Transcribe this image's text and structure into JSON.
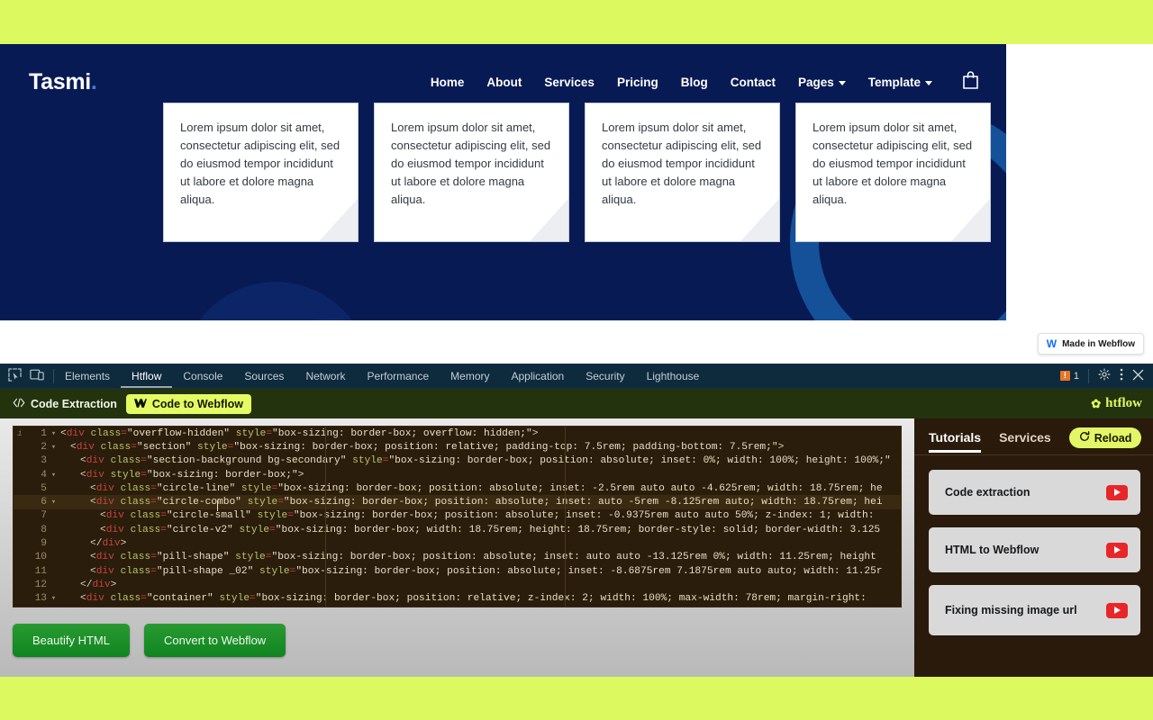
{
  "website": {
    "brand": {
      "name": "Tasmi",
      "dot": "."
    },
    "nav": [
      {
        "label": "Home",
        "caret": false
      },
      {
        "label": "About",
        "caret": false
      },
      {
        "label": "Services",
        "caret": false
      },
      {
        "label": "Pricing",
        "caret": false
      },
      {
        "label": "Blog",
        "caret": false
      },
      {
        "label": "Contact",
        "caret": false
      },
      {
        "label": "Pages",
        "caret": true
      },
      {
        "label": "Template",
        "caret": true
      }
    ],
    "cart_icon": "shopping-bag-icon",
    "cards": [
      {
        "text": "Lorem ipsum dolor sit amet, consectetur adipiscing elit, sed do eiusmod tempor incididunt ut labore et dolore magna aliqua."
      },
      {
        "text": "Lorem ipsum dolor sit amet, consectetur adipiscing elit, sed do eiusmod tempor incididunt ut labore et dolore magna aliqua."
      },
      {
        "text": "Lorem ipsum dolor sit amet, consectetur adipiscing elit, sed do eiusmod tempor incididunt ut labore et dolore magna aliqua."
      },
      {
        "text": "Lorem ipsum dolor sit amet, consectetur adipiscing elit, sed do eiusmod tempor incididunt ut labore et dolore magna aliqua."
      }
    ],
    "badge": {
      "logo": "webflow-logo-icon",
      "label": "Made in Webflow"
    },
    "colors": {
      "hero_bg": "#071a54",
      "ring": "#145199",
      "page_bg": "#dcf95f"
    }
  },
  "devtools": {
    "left_icons": [
      "inspect-element-icon",
      "device-toolbar-icon"
    ],
    "tabs": [
      {
        "label": "Elements",
        "active": false
      },
      {
        "label": "Htflow",
        "active": true
      },
      {
        "label": "Console",
        "active": false
      },
      {
        "label": "Sources",
        "active": false
      },
      {
        "label": "Network",
        "active": false
      },
      {
        "label": "Performance",
        "active": false
      },
      {
        "label": "Memory",
        "active": false
      },
      {
        "label": "Application",
        "active": false
      },
      {
        "label": "Security",
        "active": false
      },
      {
        "label": "Lighthouse",
        "active": false
      }
    ],
    "error_count": "1",
    "right_icons": [
      "settings-gear-icon",
      "more-options-icon",
      "close-icon"
    ]
  },
  "htflow": {
    "toolbar": {
      "code_extraction": "Code Extraction",
      "code_extraction_icon": "code-brackets-icon",
      "code_to_webflow": "Code to Webflow",
      "code_to_webflow_icon": "webflow-logo-icon",
      "brand": "htflow",
      "brand_icon": "htflow-logo-icon"
    },
    "editor": {
      "lines": [
        {
          "n": "1",
          "fold": "▾",
          "indent": 0,
          "tokens": [
            {
              "t": "br",
              "v": "<"
            },
            {
              "t": "tg",
              "v": "div"
            },
            {
              "t": "pn",
              "v": " class"
            },
            {
              "t": "eq",
              "v": "="
            },
            {
              "t": "st",
              "v": "\"overflow-hidden\""
            },
            {
              "t": "pn",
              "v": " style"
            },
            {
              "t": "eq",
              "v": "="
            },
            {
              "t": "st",
              "v": "\"box-sizing: border-box; overflow: hidden;\""
            },
            {
              "t": "br",
              "v": ">"
            }
          ]
        },
        {
          "n": "2",
          "fold": "▾",
          "indent": 1,
          "tokens": [
            {
              "t": "br",
              "v": "<"
            },
            {
              "t": "tg",
              "v": "div"
            },
            {
              "t": "pn",
              "v": " class"
            },
            {
              "t": "eq",
              "v": "="
            },
            {
              "t": "st",
              "v": "\"section\""
            },
            {
              "t": "pn",
              "v": " style"
            },
            {
              "t": "eq",
              "v": "="
            },
            {
              "t": "st",
              "v": "\"box-sizing: border-box; position: relative; padding-top: 7.5rem; padding-bottom: 7.5rem;\""
            },
            {
              "t": "br",
              "v": ">"
            }
          ]
        },
        {
          "n": "3",
          "fold": "",
          "indent": 2,
          "tokens": [
            {
              "t": "br",
              "v": "<"
            },
            {
              "t": "tg",
              "v": "div"
            },
            {
              "t": "pn",
              "v": " class"
            },
            {
              "t": "eq",
              "v": "="
            },
            {
              "t": "st",
              "v": "\"section-background bg-secondary\""
            },
            {
              "t": "pn",
              "v": " style"
            },
            {
              "t": "eq",
              "v": "="
            },
            {
              "t": "st",
              "v": "\"box-sizing: border-box; position: absolute; inset: 0%; width: 100%; height: 100%;\""
            }
          ]
        },
        {
          "n": "4",
          "fold": "▾",
          "indent": 2,
          "tokens": [
            {
              "t": "br",
              "v": "<"
            },
            {
              "t": "tg",
              "v": "div"
            },
            {
              "t": "pn",
              "v": " style"
            },
            {
              "t": "eq",
              "v": "="
            },
            {
              "t": "st",
              "v": "\"box-sizing: border-box;\""
            },
            {
              "t": "br",
              "v": ">"
            }
          ]
        },
        {
          "n": "5",
          "fold": "",
          "indent": 3,
          "tokens": [
            {
              "t": "br",
              "v": "<"
            },
            {
              "t": "tg",
              "v": "div"
            },
            {
              "t": "pn",
              "v": " class"
            },
            {
              "t": "eq",
              "v": "="
            },
            {
              "t": "st",
              "v": "\"circle-line\""
            },
            {
              "t": "pn",
              "v": " style"
            },
            {
              "t": "eq",
              "v": "="
            },
            {
              "t": "st",
              "v": "\"box-sizing: border-box; position: absolute; inset: -2.5rem auto auto -4.625rem; width: 18.75rem; he"
            }
          ]
        },
        {
          "n": "6",
          "fold": "▾",
          "indent": 3,
          "active": true,
          "tokens": [
            {
              "t": "br",
              "v": "<"
            },
            {
              "t": "tg",
              "v": "div"
            },
            {
              "t": "pn",
              "v": " class"
            },
            {
              "t": "eq",
              "v": "="
            },
            {
              "t": "st",
              "v": "\"circle-combo\""
            },
            {
              "t": "pn",
              "v": " style"
            },
            {
              "t": "eq",
              "v": "="
            },
            {
              "t": "st",
              "v": "\"box-sizing: border-box; position: absolute; inset: auto -5rem -8.125rem auto; width: 18.75rem; hei"
            }
          ]
        },
        {
          "n": "7",
          "fold": "",
          "indent": 4,
          "tokens": [
            {
              "t": "br",
              "v": "<"
            },
            {
              "t": "tg",
              "v": "div"
            },
            {
              "t": "pn",
              "v": " class"
            },
            {
              "t": "eq",
              "v": "="
            },
            {
              "t": "st",
              "v": "\"circle-small\""
            },
            {
              "t": "pn",
              "v": " style"
            },
            {
              "t": "eq",
              "v": "="
            },
            {
              "t": "st",
              "v": "\"box-sizing: border-box; position: absolute; inset: -0.9375rem auto auto 50%; z-index: 1; width:"
            }
          ]
        },
        {
          "n": "8",
          "fold": "",
          "indent": 4,
          "tokens": [
            {
              "t": "br",
              "v": "<"
            },
            {
              "t": "tg",
              "v": "div"
            },
            {
              "t": "pn",
              "v": " class"
            },
            {
              "t": "eq",
              "v": "="
            },
            {
              "t": "st",
              "v": "\"circle-v2\""
            },
            {
              "t": "pn",
              "v": " style"
            },
            {
              "t": "eq",
              "v": "="
            },
            {
              "t": "st",
              "v": "\"box-sizing: border-box; width: 18.75rem; height: 18.75rem; border-style: solid; border-width: 3.125"
            }
          ]
        },
        {
          "n": "9",
          "fold": "",
          "indent": 3,
          "tokens": [
            {
              "t": "br",
              "v": "</"
            },
            {
              "t": "tg",
              "v": "div"
            },
            {
              "t": "br",
              "v": ">"
            }
          ]
        },
        {
          "n": "10",
          "fold": "",
          "indent": 3,
          "tokens": [
            {
              "t": "br",
              "v": "<"
            },
            {
              "t": "tg",
              "v": "div"
            },
            {
              "t": "pn",
              "v": " class"
            },
            {
              "t": "eq",
              "v": "="
            },
            {
              "t": "st",
              "v": "\"pill-shape\""
            },
            {
              "t": "pn",
              "v": " style"
            },
            {
              "t": "eq",
              "v": "="
            },
            {
              "t": "st",
              "v": "\"box-sizing: border-box; position: absolute; inset: auto auto -13.125rem 0%; width: 11.25rem; height"
            }
          ]
        },
        {
          "n": "11",
          "fold": "",
          "indent": 3,
          "tokens": [
            {
              "t": "br",
              "v": "<"
            },
            {
              "t": "tg",
              "v": "div"
            },
            {
              "t": "pn",
              "v": " class"
            },
            {
              "t": "eq",
              "v": "="
            },
            {
              "t": "st",
              "v": "\"pill-shape _02\""
            },
            {
              "t": "pn",
              "v": " style"
            },
            {
              "t": "eq",
              "v": "="
            },
            {
              "t": "st",
              "v": "\"box-sizing: border-box; position: absolute; inset: -8.6875rem 7.1875rem auto auto; width: 11.25r"
            }
          ]
        },
        {
          "n": "12",
          "fold": "",
          "indent": 2,
          "tokens": [
            {
              "t": "br",
              "v": "</"
            },
            {
              "t": "tg",
              "v": "div"
            },
            {
              "t": "br",
              "v": ">"
            }
          ]
        },
        {
          "n": "13",
          "fold": "▾",
          "indent": 2,
          "tokens": [
            {
              "t": "br",
              "v": "<"
            },
            {
              "t": "tg",
              "v": "div"
            },
            {
              "t": "pn",
              "v": " class"
            },
            {
              "t": "eq",
              "v": "="
            },
            {
              "t": "st",
              "v": "\"container\""
            },
            {
              "t": "pn",
              "v": " style"
            },
            {
              "t": "eq",
              "v": "="
            },
            {
              "t": "st",
              "v": "\"box-sizing: border-box; position: relative; z-index: 2; width: 100%; max-width: 78rem; margin-right:"
            }
          ]
        }
      ],
      "buttons": [
        {
          "label": "Beautify HTML"
        },
        {
          "label": "Convert to Webflow"
        }
      ]
    },
    "panel": {
      "tabs": [
        {
          "label": "Tutorials",
          "active": true
        },
        {
          "label": "Services",
          "active": false
        }
      ],
      "reload": {
        "label": "Reload",
        "icon": "refresh-icon"
      },
      "tutorials": [
        {
          "title": "Code extraction",
          "play": "youtube-play-icon"
        },
        {
          "title": "HTML to Webflow",
          "play": "youtube-play-icon"
        },
        {
          "title": "Fixing missing image url",
          "play": "youtube-play-icon"
        }
      ]
    }
  }
}
